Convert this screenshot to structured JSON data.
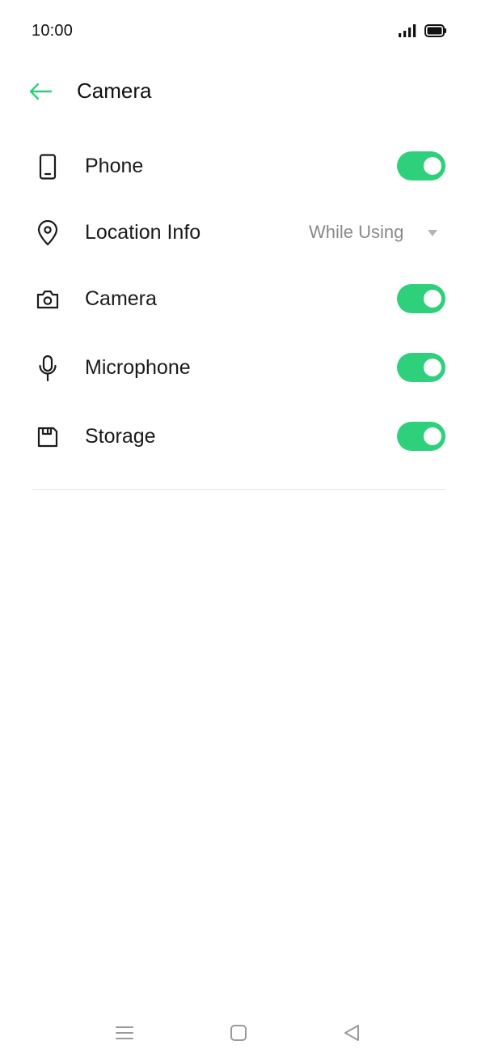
{
  "status_bar": {
    "time": "10:00",
    "signal_icon": "signal-bars-icon",
    "battery_icon": "battery-full-icon"
  },
  "header": {
    "back_icon": "arrow-left-icon",
    "title": "Camera"
  },
  "permissions": [
    {
      "label": "Phone",
      "icon": "phone-icon",
      "control": "toggle",
      "enabled": true
    },
    {
      "label": "Location Info",
      "icon": "location-pin-icon",
      "control": "dropdown",
      "value": "While Using"
    },
    {
      "label": "Camera",
      "icon": "camera-icon",
      "control": "toggle",
      "enabled": true
    },
    {
      "label": "Microphone",
      "icon": "microphone-icon",
      "control": "toggle",
      "enabled": true
    },
    {
      "label": "Storage",
      "icon": "storage-icon",
      "control": "toggle",
      "enabled": true
    }
  ],
  "nav_bar": {
    "menu_icon": "menu-lines-icon",
    "home_icon": "home-square-icon",
    "back_icon": "back-triangle-icon"
  },
  "colors": {
    "accent": "#2ed07c",
    "text": "#1a1a1a",
    "secondary_text": "#8a8a8a",
    "divider": "#e6e6e6",
    "nav_icon": "#9a9a9a"
  }
}
